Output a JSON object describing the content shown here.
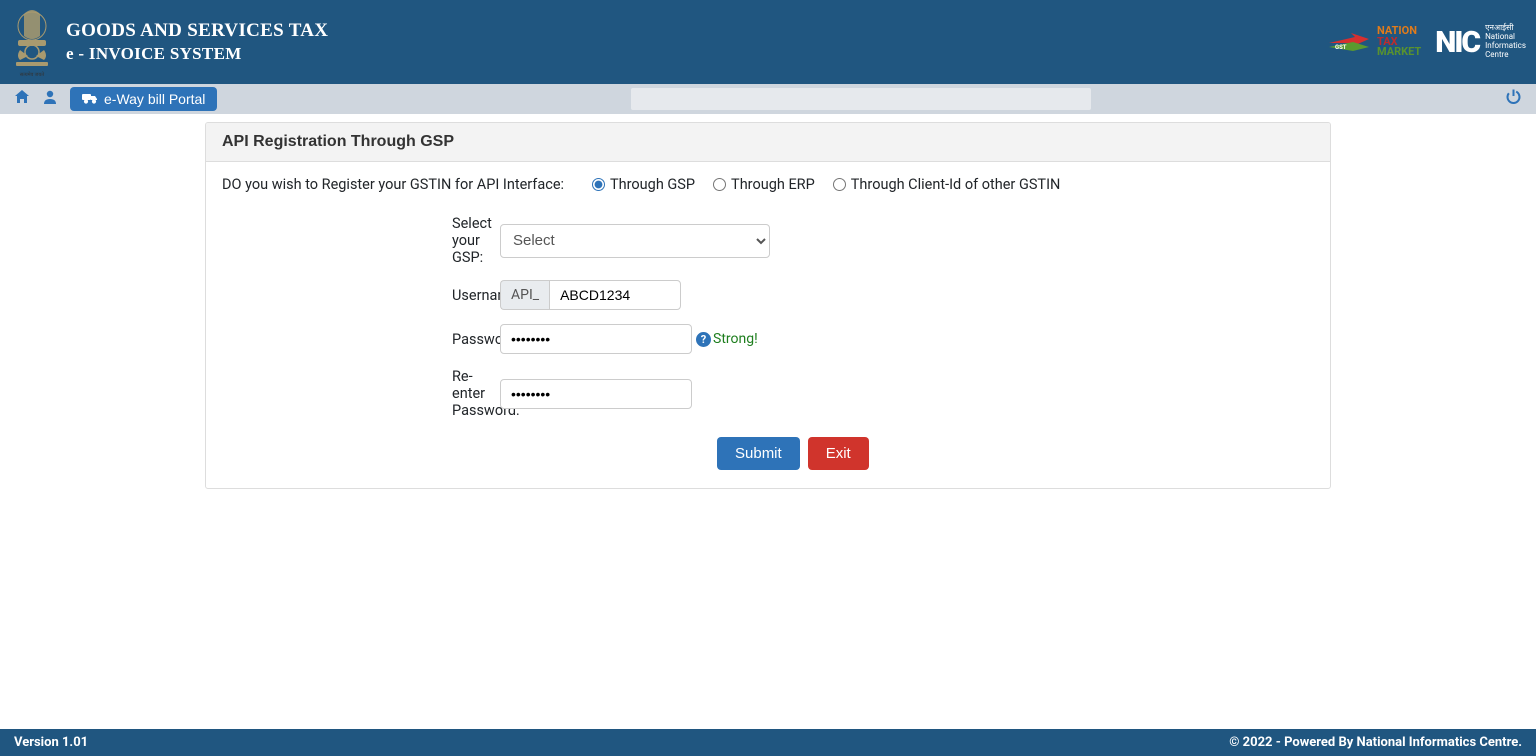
{
  "header": {
    "title_line1": "GOODS AND SERVICES TAX",
    "title_line2": "e - INVOICE SYSTEM",
    "ntm_line1": "NATION",
    "ntm_line2": "TAX",
    "ntm_line3": "MARKET",
    "nic_label": "NIC",
    "nic_sub1": "एनआईसी",
    "nic_sub2": "National",
    "nic_sub3": "Informatics",
    "nic_sub4": "Centre"
  },
  "subbar": {
    "eway_label": "e-Way bill Portal"
  },
  "card": {
    "title": "API Registration Through GSP",
    "question": "DO you wish to Register your GSTIN for API Interface:",
    "radios": {
      "gsp": "Through GSP",
      "erp": "Through ERP",
      "client": "Through Client-Id of other GSTIN"
    },
    "labels": {
      "select_gsp": "Select your GSP:",
      "username": "Username:",
      "password": "Password:",
      "reenter": "Re-enter Password:"
    },
    "gsp_select_value": "Select",
    "username_prefix": "API_",
    "username_value": "ABCD1234",
    "password_value": "••••••••",
    "reenter_value": "••••••••",
    "strength_label": "Strong!",
    "submit_label": "Submit",
    "exit_label": "Exit"
  },
  "footer": {
    "version": "Version 1.01",
    "copyright": "© 2022 - Powered By National Informatics Centre."
  }
}
